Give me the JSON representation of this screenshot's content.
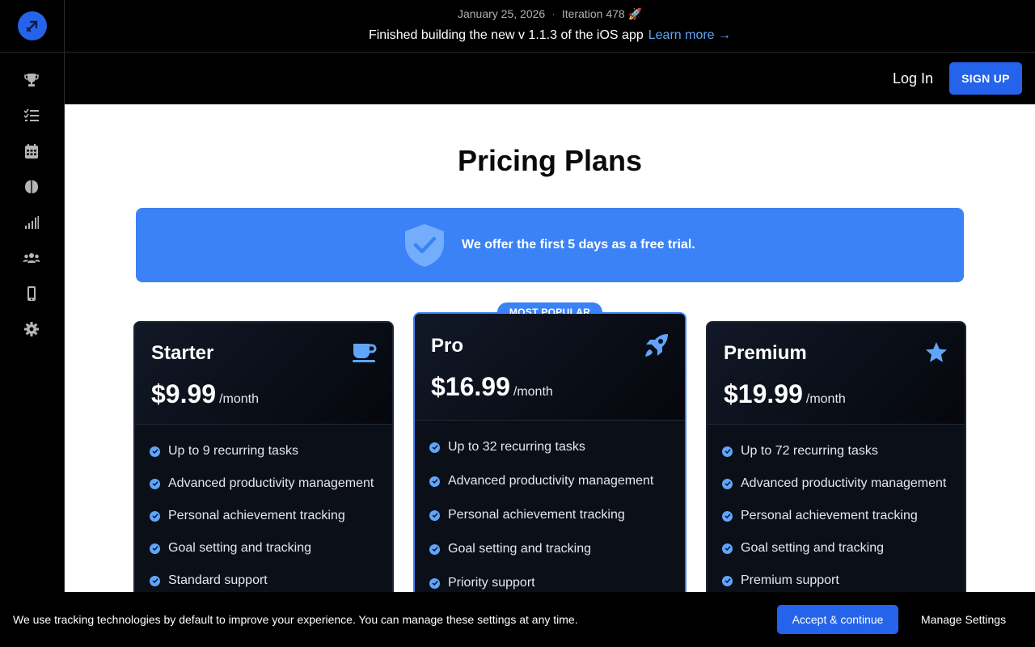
{
  "header": {
    "date": "January 25, 2026",
    "iteration": "Iteration 478 🚀",
    "announcement": "Finished building the new v 1.1.3 of the iOS app",
    "learn_more": "Learn more →"
  },
  "auth": {
    "login": "Log In",
    "signup": "SIGN UP"
  },
  "sidebar": {
    "icons": [
      "trophy-icon",
      "task-list-icon",
      "calendar-icon",
      "brain-icon",
      "signal-bars-icon",
      "users-icon",
      "mobile-icon",
      "gear-icon"
    ]
  },
  "main": {
    "title": "Pricing Plans",
    "trial_text": "We offer the first 5 days as a free trial."
  },
  "plans": [
    {
      "name": "Starter",
      "price": "$9.99",
      "period": "/month",
      "icon": "coffee-icon",
      "features": [
        "Up to 9 recurring tasks",
        "Advanced productivity management",
        "Personal achievement tracking",
        "Goal setting and tracking",
        "Standard support"
      ]
    },
    {
      "name": "Pro",
      "price": "$16.99",
      "period": "/month",
      "icon": "rocket-icon",
      "badge": "MOST POPULAR",
      "features": [
        "Up to 32 recurring tasks",
        "Advanced productivity management",
        "Personal achievement tracking",
        "Goal setting and tracking",
        "Priority support"
      ]
    },
    {
      "name": "Premium",
      "price": "$19.99",
      "period": "/month",
      "icon": "star-icon",
      "features": [
        "Up to 72 recurring tasks",
        "Advanced productivity management",
        "Personal achievement tracking",
        "Goal setting and tracking",
        "Premium support"
      ]
    }
  ],
  "cookie": {
    "text": "We use tracking technologies by default to improve your experience. You can manage these settings at any time.",
    "accept": "Accept & continue",
    "manage": "Manage Settings"
  },
  "colors": {
    "accent": "#3b82f6",
    "button": "#2563eb",
    "card_bg": "#0b0f18"
  }
}
